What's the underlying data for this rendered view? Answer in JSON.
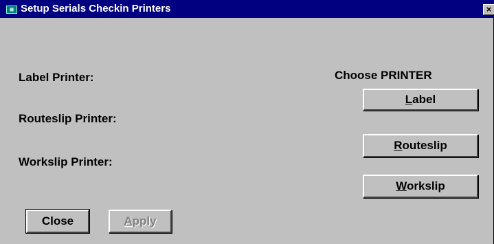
{
  "window": {
    "title": "Setup Serials Checkin Printers",
    "icon": "app-icon",
    "close_glyph": "×"
  },
  "labels": {
    "label_printer": "Label Printer:",
    "routeslip_printer": "Routeslip Printer:",
    "workslip_printer": "Workslip Printer:",
    "choose_printer": "Choose PRINTER"
  },
  "buttons": {
    "label": {
      "mnemonic": "L",
      "rest": "abel"
    },
    "routeslip": {
      "mnemonic": "R",
      "rest": "outeslip"
    },
    "workslip": {
      "mnemonic": "W",
      "rest": "orkslip"
    },
    "close": "Close",
    "apply": {
      "mnemonic": "A",
      "rest": "pply",
      "enabled": false
    }
  }
}
